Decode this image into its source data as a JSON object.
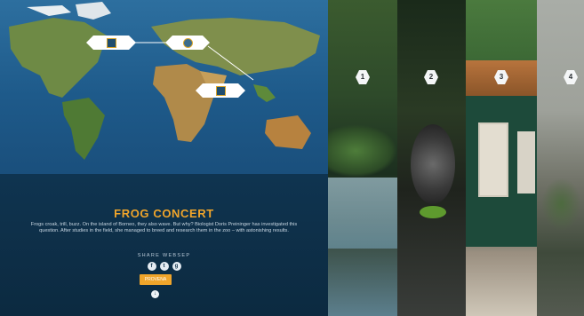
{
  "map": {
    "markers": [
      {
        "text": "",
        "icon": "logo-badge"
      },
      {
        "text": "",
        "icon": "globe-logo"
      },
      {
        "text": "",
        "icon": "logo-badge"
      }
    ]
  },
  "info": {
    "title": "FROG CONCERT",
    "description": "Frogs croak, trill, buzz. On the island of Borneo, they also wave. But why? Biologist Doris Preininger has investigated this question. After studies in the field, she managed to breed and research them in the zoo – with astonishing results.",
    "share_label": "SHARE WEBSEP",
    "social": [
      "f",
      "t",
      "g"
    ],
    "button_label": "PROVENA"
  },
  "panels": [
    {
      "number": "1"
    },
    {
      "number": "2"
    },
    {
      "number": "3"
    },
    {
      "number": "4"
    }
  ],
  "colors": {
    "accent": "#f0a52b",
    "info_bg": "#0f3450",
    "map_ocean": "#1e5a8a"
  }
}
